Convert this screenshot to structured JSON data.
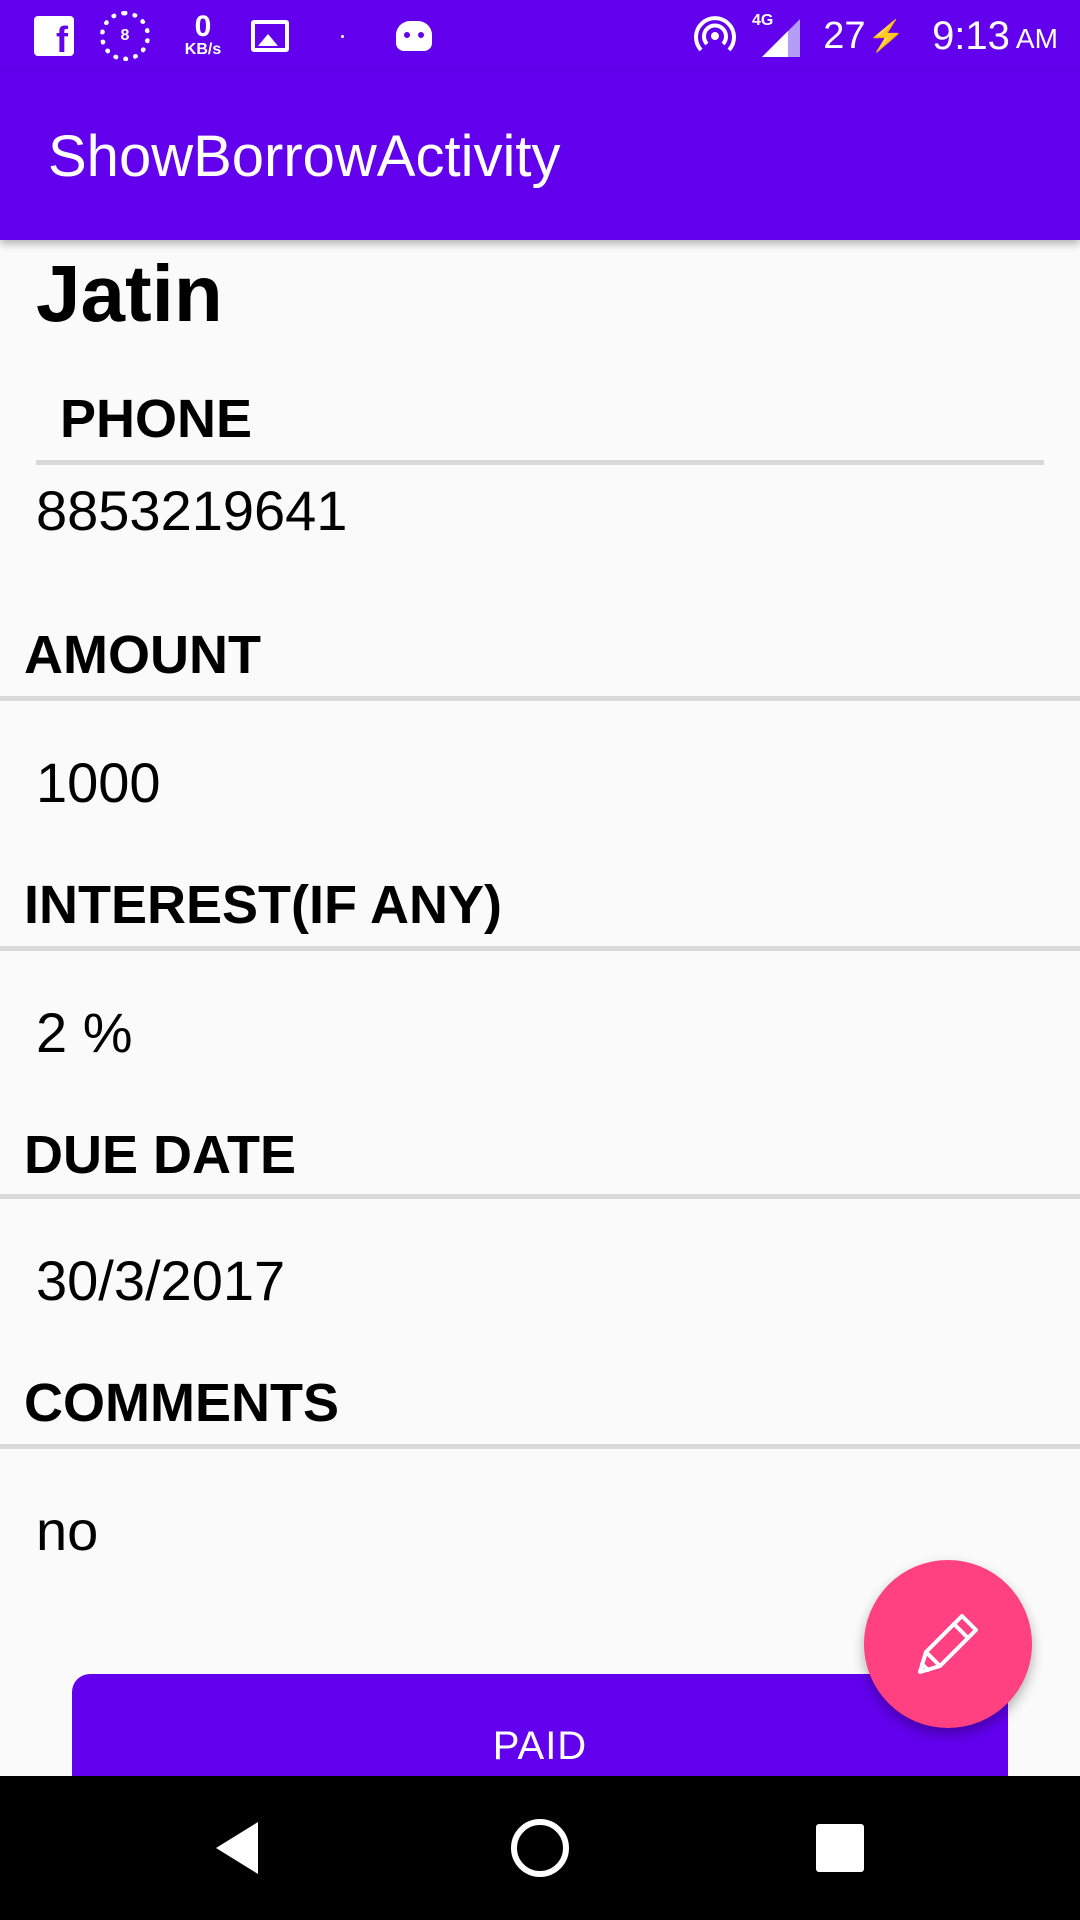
{
  "status_bar": {
    "network_speed_value": "0",
    "network_speed_unit": "KB/s",
    "notification_badge": "8",
    "network_type": "4G",
    "battery_level": "27",
    "time": "9:13",
    "am_pm": "AM",
    "icons": [
      "facebook-icon",
      "notification-badge-icon",
      "image-icon",
      "android-icon",
      "hotspot-icon",
      "signal-icon",
      "charging-icon"
    ]
  },
  "app_bar": {
    "title": "ShowBorrowActivity"
  },
  "record": {
    "name": "Jatin",
    "phone_label": "PHONE",
    "phone_value": "8853219641",
    "amount_label": "AMOUNT",
    "amount_value": "1000",
    "interest_label": "INTEREST(IF ANY)",
    "interest_value": "2 %",
    "due_date_label": "DUE DATE",
    "due_date_value": "30/3/2017",
    "comments_label": "COMMENTS",
    "comments_value": "no"
  },
  "actions": {
    "paid_label": "PAID",
    "edit_icon": "pencil-icon"
  },
  "nav_bar": {
    "icons": [
      "back-icon",
      "home-icon",
      "recents-icon"
    ]
  },
  "colors": {
    "primary": "#6200ee",
    "accent": "#ff4081",
    "background": "#fafafa",
    "divider": "#d9d9d9"
  }
}
